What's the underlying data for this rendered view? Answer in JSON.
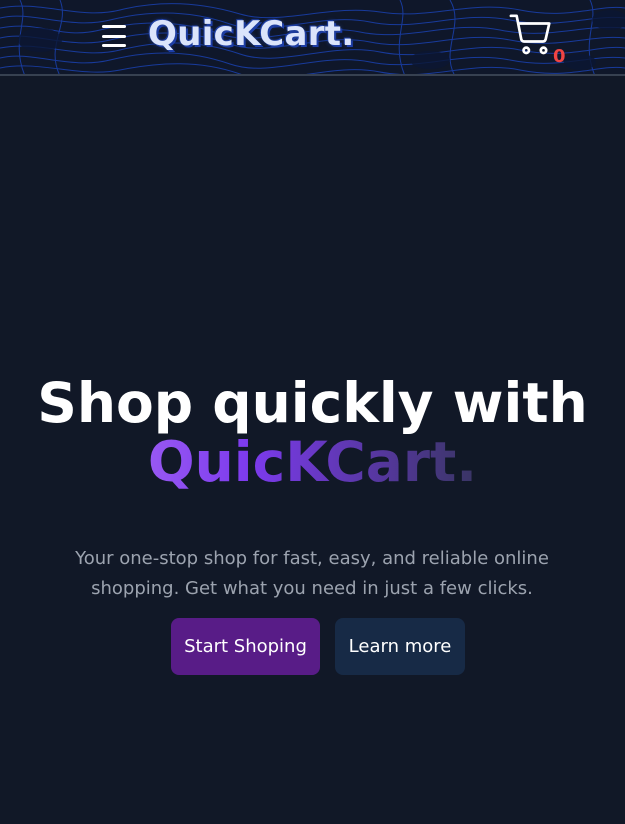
{
  "header": {
    "brand": "QuicKCart.",
    "cart_count": "0"
  },
  "hero": {
    "title_line": "Shop quickly with",
    "brand": "QuicKCart.",
    "description": "Your one-stop shop for fast, easy, and reliable online shopping. Get what you need in just a few clicks.",
    "primary_button": "Start Shoping",
    "secondary_button": "Learn more"
  },
  "icons": {
    "menu": "hamburger-menu-icon",
    "cart": "shopping-cart-icon"
  },
  "colors": {
    "background": "#111827",
    "primary_button": "#581c87",
    "secondary_button": "#172a46",
    "cart_badge": "#ef4444",
    "brand_gradient_start": "#c084fc"
  }
}
